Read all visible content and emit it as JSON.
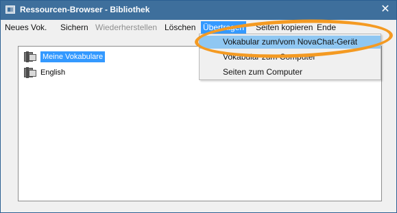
{
  "window": {
    "title": "Ressourcen-Browser - Bibliothek",
    "close_glyph": "✕"
  },
  "menu": {
    "items": [
      {
        "label": "Neues Vok.",
        "enabled": true
      },
      {
        "label": "Sichern",
        "enabled": true
      },
      {
        "label": "Wiederherstellen",
        "enabled": false
      },
      {
        "label": "Löschen",
        "enabled": true
      },
      {
        "label": "Übertragen",
        "enabled": true,
        "active": true
      },
      {
        "label": "Seiten kopieren",
        "enabled": true
      },
      {
        "label": "Ende",
        "enabled": true
      }
    ]
  },
  "library": {
    "items": [
      {
        "label": "Meine Vokabulare",
        "selected": true,
        "icon": "book-stack-icon"
      },
      {
        "label": "English",
        "selected": false,
        "icon": "book-stack-icon"
      }
    ]
  },
  "dropdown": {
    "items": [
      {
        "label": "Vokabular zum/vom NovaChat-Gerät",
        "highlighted": true
      },
      {
        "label": "Vokabular zum Computer",
        "highlighted": false
      },
      {
        "label": "Seiten zum Computer",
        "highlighted": false
      }
    ]
  },
  "colors": {
    "title_bar": "#3e6f9c",
    "selection": "#3399ff",
    "menu_highlight": "#8fc7f2",
    "annotation": "#f49a22"
  },
  "icons": {
    "app": "resource-browser-icon",
    "close": "close-icon",
    "tree_item": "book-stack-icon"
  }
}
